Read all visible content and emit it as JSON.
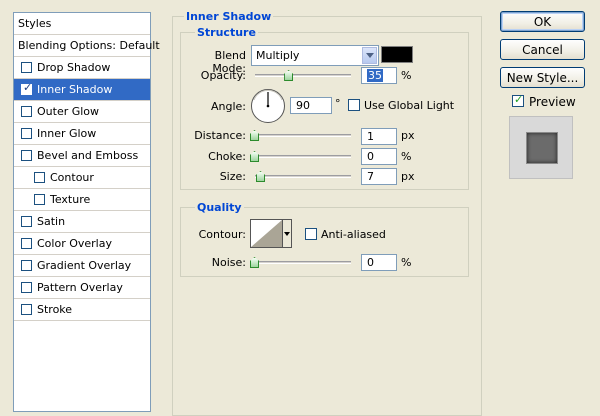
{
  "styles_panel": {
    "header": "Styles",
    "items": [
      {
        "label": "Blending Options: Default",
        "checkbox": false,
        "checked": false,
        "indent": false,
        "selected": false
      },
      {
        "label": "Drop Shadow",
        "checkbox": true,
        "checked": false,
        "indent": false,
        "selected": false
      },
      {
        "label": "Inner Shadow",
        "checkbox": true,
        "checked": true,
        "indent": false,
        "selected": true
      },
      {
        "label": "Outer Glow",
        "checkbox": true,
        "checked": false,
        "indent": false,
        "selected": false
      },
      {
        "label": "Inner Glow",
        "checkbox": true,
        "checked": false,
        "indent": false,
        "selected": false
      },
      {
        "label": "Bevel and Emboss",
        "checkbox": true,
        "checked": false,
        "indent": false,
        "selected": false
      },
      {
        "label": "Contour",
        "checkbox": true,
        "checked": false,
        "indent": true,
        "selected": false
      },
      {
        "label": "Texture",
        "checkbox": true,
        "checked": false,
        "indent": true,
        "selected": false
      },
      {
        "label": "Satin",
        "checkbox": true,
        "checked": false,
        "indent": false,
        "selected": false
      },
      {
        "label": "Color Overlay",
        "checkbox": true,
        "checked": false,
        "indent": false,
        "selected": false
      },
      {
        "label": "Gradient Overlay",
        "checkbox": true,
        "checked": false,
        "indent": false,
        "selected": false
      },
      {
        "label": "Pattern Overlay",
        "checkbox": true,
        "checked": false,
        "indent": false,
        "selected": false
      },
      {
        "label": "Stroke",
        "checkbox": true,
        "checked": false,
        "indent": false,
        "selected": false
      }
    ]
  },
  "inner_shadow": {
    "title": "Inner Shadow",
    "structure": {
      "title": "Structure",
      "blend_mode_label": "Blend Mode:",
      "blend_mode_value": "Multiply",
      "shadow_color": "#000000",
      "opacity_label": "Opacity:",
      "opacity_value": "35",
      "opacity_unit": "%",
      "opacity_fraction": 0.35,
      "angle_label": "Angle:",
      "angle_value": "90",
      "angle_unit": "°",
      "use_global_light_label": "Use Global Light",
      "use_global_light_checked": false,
      "distance_label": "Distance:",
      "distance_value": "1",
      "distance_unit": "px",
      "choke_label": "Choke:",
      "choke_value": "0",
      "choke_unit": "%",
      "size_label": "Size:",
      "size_value": "7",
      "size_unit": "px"
    },
    "quality": {
      "title": "Quality",
      "contour_label": "Contour:",
      "anti_aliased_label": "Anti-aliased",
      "anti_aliased_checked": false,
      "noise_label": "Noise:",
      "noise_value": "0",
      "noise_unit": "%"
    }
  },
  "buttons": {
    "ok": "OK",
    "cancel": "Cancel",
    "new_style": "New Style...",
    "preview_label": "Preview",
    "preview_checked": true
  },
  "colors": {
    "selection": "#316ac5",
    "group_title": "#0046d5",
    "dialog_bg": "#ece9d8"
  }
}
